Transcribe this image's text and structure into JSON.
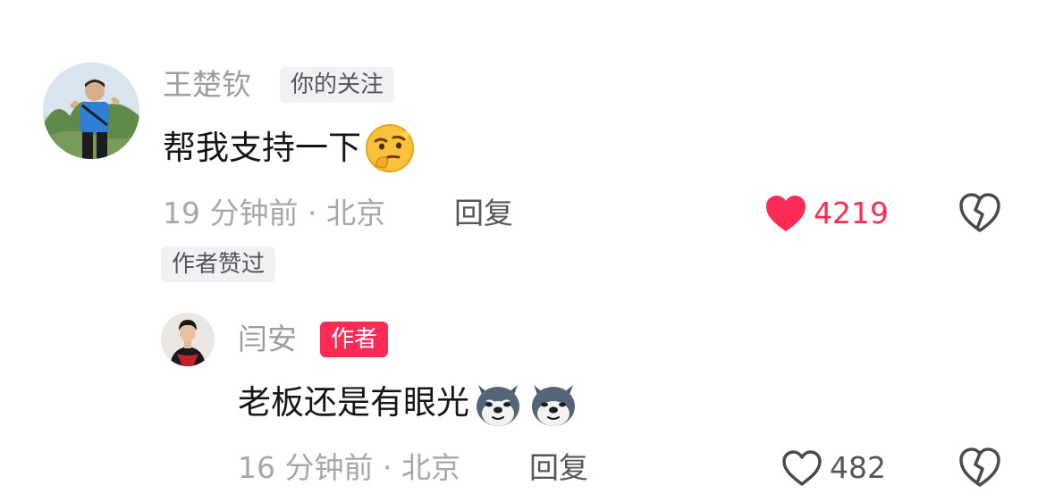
{
  "comment": {
    "username": "王楚钦",
    "badge": "你的关注",
    "text": "帮我支持一下",
    "emoji": "thinking-smirk-emoji",
    "time": "19 分钟前 · 北京",
    "reply_label": "回复",
    "likes": "4219",
    "liked": true,
    "author_liked_label": "作者赞过"
  },
  "reply": {
    "username": "闫安",
    "badge": "作者",
    "text": "老板还是有眼光",
    "emojis": [
      "husky-dog-emoji",
      "husky-dog-emoji"
    ],
    "time": "16 分钟前 · 北京",
    "reply_label": "回复",
    "likes": "482",
    "liked": false
  },
  "colors": {
    "accent": "#fe2c55",
    "muted_text": "#a6a6ad",
    "like_active": "#fe2c55"
  }
}
